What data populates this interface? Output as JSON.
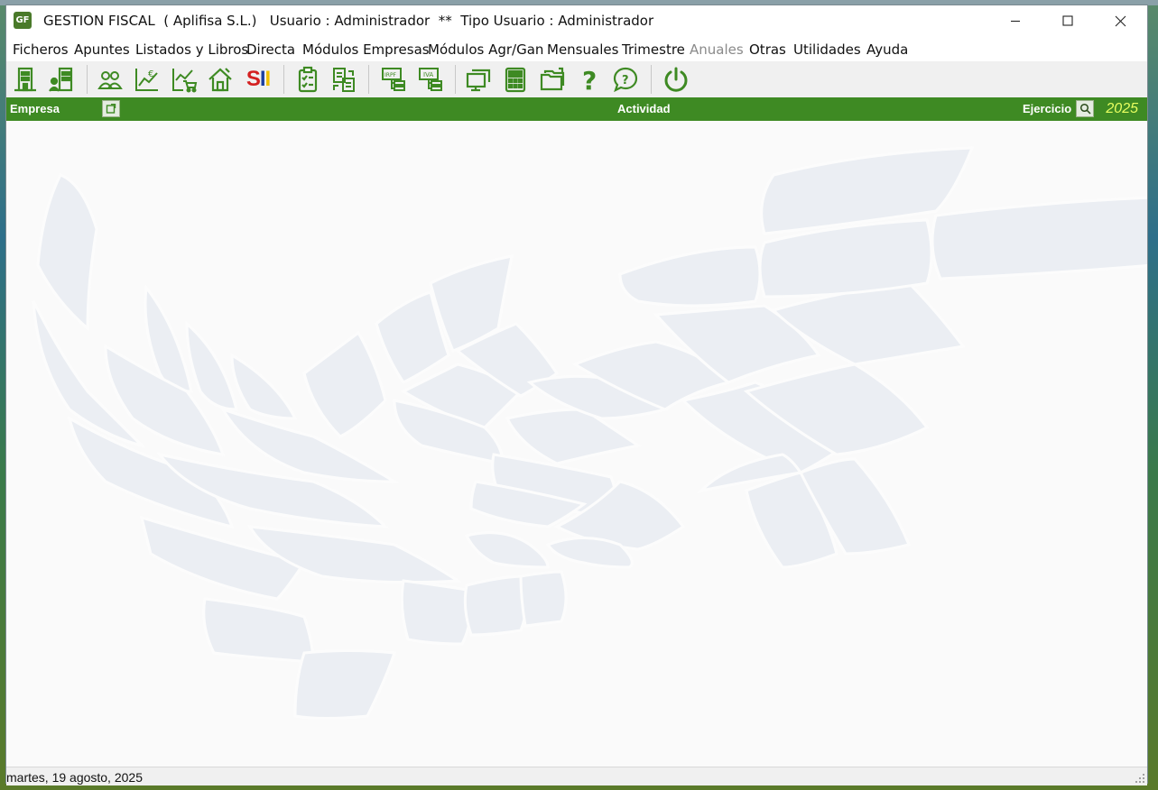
{
  "window": {
    "app_icon_text": "GF",
    "title": "GESTION FISCAL  ( Aplifisa S.L.)   Usuario : Administrador  **  Tipo Usuario : Administrador"
  },
  "menu": [
    {
      "label": "Ficheros",
      "enabled": true
    },
    {
      "label": "Apuntes",
      "enabled": true
    },
    {
      "label": "Listados y Libros",
      "enabled": true
    },
    {
      "label": "Directa",
      "enabled": true
    },
    {
      "label": "Módulos Empresas",
      "enabled": true
    },
    {
      "label": "Módulos Agr/Gan",
      "enabled": true
    },
    {
      "label": "Mensuales",
      "enabled": true
    },
    {
      "label": "Trimestre",
      "enabled": true
    },
    {
      "label": "Anuales",
      "enabled": false
    },
    {
      "label": "Otras",
      "enabled": true
    },
    {
      "label": "Utilidades",
      "enabled": true
    },
    {
      "label": "Ayuda",
      "enabled": true
    }
  ],
  "toolbar": {
    "sii_text": "SII",
    "icons": [
      "building-icon",
      "company-worker-icon",
      "users-icon",
      "euro-chart-icon",
      "cart-chart-icon",
      "house-icon",
      "sii-icon",
      "clipboard-check-icon",
      "document-transfer-icon",
      "irpf-icon",
      "iva-icon",
      "monitor-icon",
      "calculator-icon",
      "folder-icon",
      "help-icon",
      "chat-help-icon",
      "power-icon"
    ],
    "colors": {
      "icon_green": "#3e8a23",
      "sii_red": "#d42020",
      "sii_blue": "#1a3fa0",
      "sii_yellow": "#f0c000"
    }
  },
  "company_bar": {
    "empresa_label": "Empresa",
    "actividad_label": "Actividad",
    "ejercicio_label": "Ejercicio",
    "year": "2025",
    "bar_color": "#3e8a23"
  },
  "status": {
    "date": "martes, 19 agosto, 2025"
  }
}
